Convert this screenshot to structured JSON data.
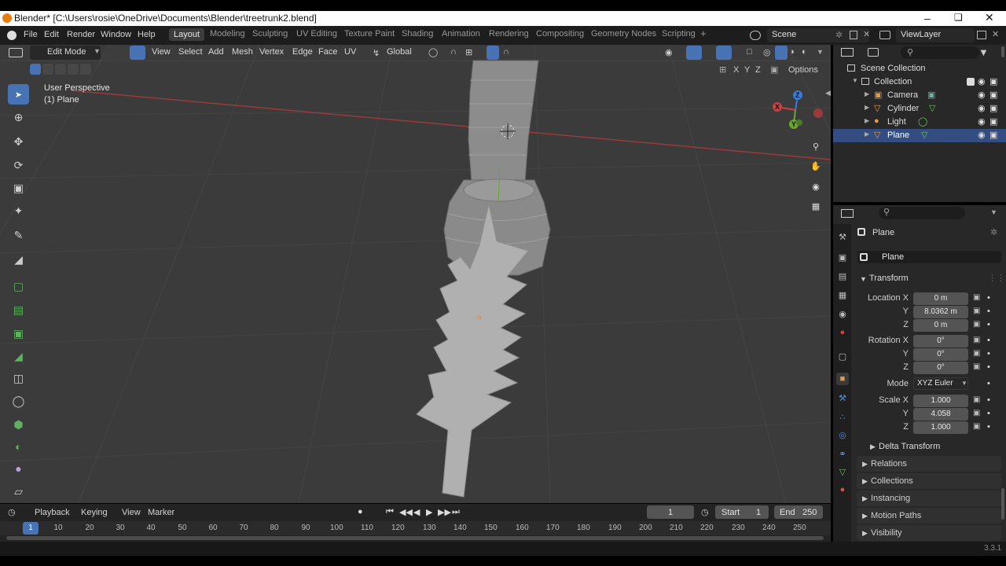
{
  "window": {
    "title": "Blender* [C:\\Users\\rosie\\OneDrive\\Documents\\Blender\\treetrunk2.blend]"
  },
  "menu": [
    "File",
    "Edit",
    "Render",
    "Window",
    "Help"
  ],
  "workspaces": [
    "Layout",
    "Modeling",
    "Sculpting",
    "UV Editing",
    "Texture Paint",
    "Shading",
    "Animation",
    "Rendering",
    "Compositing",
    "Geometry Nodes",
    "Scripting",
    "+"
  ],
  "scene_name": "Scene",
  "view_layer": "ViewLayer",
  "viewport": {
    "mode": "Edit Mode",
    "menus": [
      "View",
      "Select",
      "Add",
      "Mesh",
      "Vertex",
      "Edge",
      "Face",
      "UV"
    ],
    "orientation": "Global",
    "options_label": "Options",
    "axes": [
      "X",
      "Y",
      "Z"
    ],
    "perspective": "User Perspective",
    "object_label": "(1) Plane",
    "gizmo": {
      "x": "X",
      "y": "Y",
      "z": "Z"
    }
  },
  "outliner": {
    "root": "Scene Collection",
    "collection": "Collection",
    "items": [
      "Camera",
      "Cylinder",
      "Light",
      "Plane"
    ]
  },
  "properties": {
    "object_name": "Plane",
    "data_name": "Plane",
    "transform_label": "Transform",
    "location_label": "Location X",
    "rotation_label": "Rotation X",
    "scale_label": "Scale X",
    "y_label": "Y",
    "z_label": "Z",
    "mode_label": "Mode",
    "location": [
      "0 m",
      "8.0362 m",
      "0 m"
    ],
    "rotation": [
      "0°",
      "0°",
      "0°"
    ],
    "mode": "XYZ Euler",
    "scale": [
      "1.000",
      "4.058",
      "1.000"
    ],
    "panels": [
      "Delta Transform",
      "Relations",
      "Collections",
      "Instancing",
      "Motion Paths",
      "Visibility"
    ]
  },
  "timeline": {
    "menus": [
      "Playback",
      "Keying",
      "View",
      "Marker"
    ],
    "current_frame": "1",
    "start_label": "Start",
    "start": "1",
    "end_label": "End",
    "end": "250",
    "ticks": [
      "1",
      "10",
      "20",
      "30",
      "40",
      "50",
      "60",
      "70",
      "80",
      "90",
      "100",
      "110",
      "120",
      "130",
      "140",
      "150",
      "160",
      "170",
      "180",
      "190",
      "200",
      "210",
      "220",
      "230",
      "240",
      "250"
    ]
  },
  "status": {
    "version": "3.3.1"
  },
  "colors": {
    "accent": "#4772b3",
    "x_axis": "#c9423f",
    "y_axis": "#6aa82a",
    "z_axis": "#3a7bd5"
  }
}
